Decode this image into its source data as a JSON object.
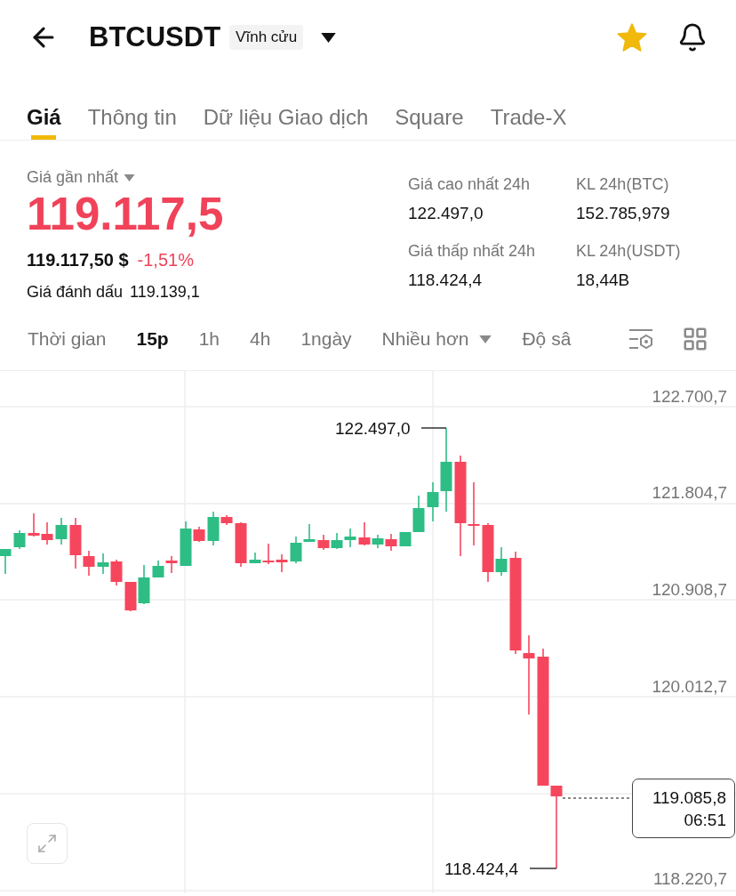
{
  "header": {
    "title": "BTCUSDT",
    "badge": "Vĩnh cửu",
    "favorite": true
  },
  "tabs": [
    {
      "label": "Giá",
      "selected": true
    },
    {
      "label": "Thông tin",
      "selected": false
    },
    {
      "label": "Dữ liệu Giao dịch",
      "selected": false
    },
    {
      "label": "Square",
      "selected": false
    },
    {
      "label": "Trade-X",
      "selected": false
    }
  ],
  "price": {
    "label": "Giá gần nhất",
    "last": "119.117,5",
    "usd": "119.117,50 $",
    "change": "-1,51%",
    "mark_label": "Giá đánh dấu",
    "mark": "119.139,1"
  },
  "stats": [
    {
      "label": "Giá cao nhất 24h",
      "value": "122.497,0"
    },
    {
      "label": "KL 24h(BTC)",
      "value": "152.785,979"
    },
    {
      "label": "Giá thấp nhất 24h",
      "value": "118.424,4"
    },
    {
      "label": "KL 24h(USDT)",
      "value": "18,44B"
    }
  ],
  "toolbar": [
    {
      "label": "Thời gian",
      "kind": "label",
      "selected": false
    },
    {
      "label": "15p",
      "kind": "interval",
      "selected": true
    },
    {
      "label": "1h",
      "kind": "interval",
      "selected": false
    },
    {
      "label": "4h",
      "kind": "interval",
      "selected": false
    },
    {
      "label": "1ngày",
      "kind": "interval",
      "selected": false
    },
    {
      "label": "Nhiều hơn",
      "kind": "dropdown",
      "selected": false
    },
    {
      "label": "Độ sâ",
      "kind": "interval",
      "selected": false
    }
  ],
  "chart": {
    "axis_labels": [
      "122.700,7",
      "121.804,7",
      "120.908,7",
      "120.012,7",
      "118.220,7"
    ],
    "high_label": "122.497,0",
    "low_label": "118.424,4",
    "last_price": "119.085,8",
    "countdown": "06:51"
  }
}
